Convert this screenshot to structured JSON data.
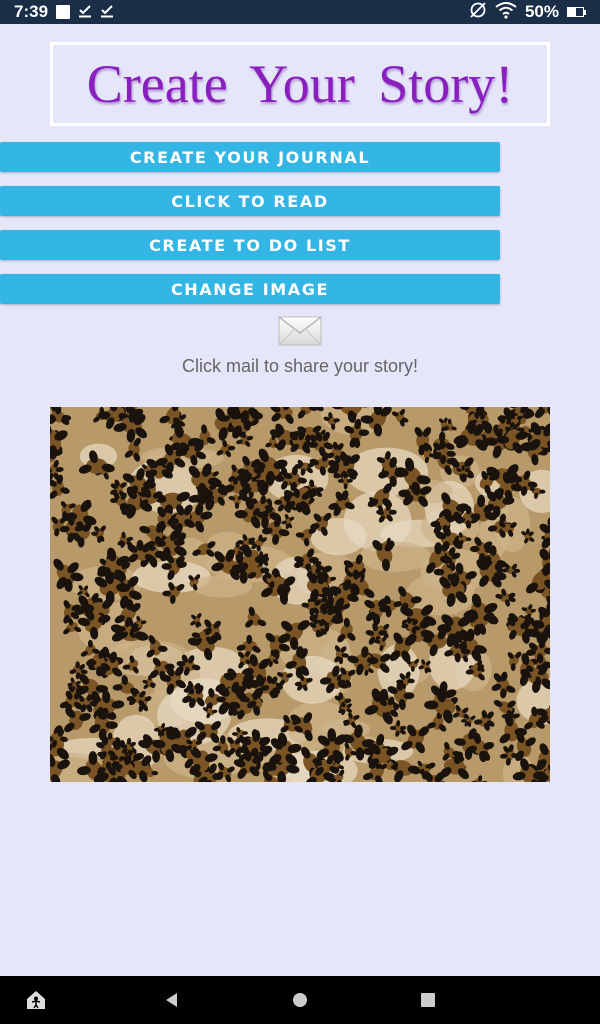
{
  "status_bar": {
    "time": "7:39",
    "battery": "50%",
    "battery_level": 0.5,
    "icons": [
      "notification-square-icon",
      "download-check-icon",
      "download-check-icon",
      "no-sim-icon",
      "wifi-icon",
      "battery-icon"
    ]
  },
  "title": "Create Your Story!",
  "buttons": {
    "journal": "CREATE YOUR JOURNAL",
    "read": "CLICK TO READ",
    "todo": "CREATE TO DO LIST",
    "change_image": "CHANGE IMAGE"
  },
  "share_caption": "Click mail to share your story!",
  "colors": {
    "background": "#e6e6fa",
    "button": "#33b5e5",
    "title": "#8a1fc0",
    "status_bar": "#1a2e48"
  },
  "nav_bar": {
    "icons": [
      "accessibility-home-icon",
      "back-icon",
      "home-icon",
      "recents-icon"
    ]
  }
}
